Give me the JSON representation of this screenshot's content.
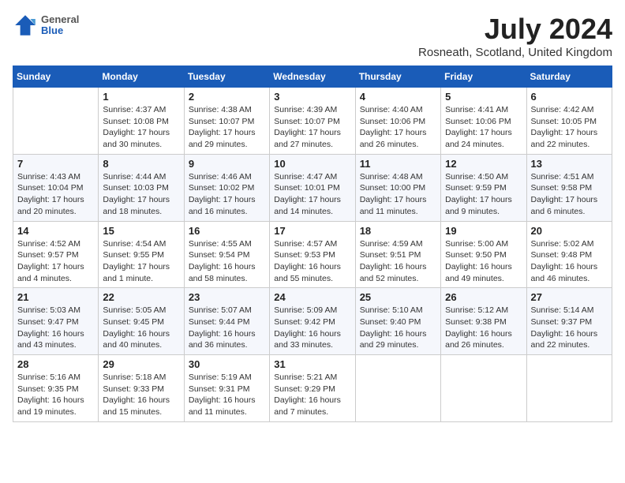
{
  "header": {
    "logo": {
      "line1": "General",
      "line2": "Blue"
    },
    "title": "July 2024",
    "location": "Rosneath, Scotland, United Kingdom"
  },
  "days_of_week": [
    "Sunday",
    "Monday",
    "Tuesday",
    "Wednesday",
    "Thursday",
    "Friday",
    "Saturday"
  ],
  "weeks": [
    [
      {
        "day": "",
        "info": ""
      },
      {
        "day": "1",
        "info": "Sunrise: 4:37 AM\nSunset: 10:08 PM\nDaylight: 17 hours\nand 30 minutes."
      },
      {
        "day": "2",
        "info": "Sunrise: 4:38 AM\nSunset: 10:07 PM\nDaylight: 17 hours\nand 29 minutes."
      },
      {
        "day": "3",
        "info": "Sunrise: 4:39 AM\nSunset: 10:07 PM\nDaylight: 17 hours\nand 27 minutes."
      },
      {
        "day": "4",
        "info": "Sunrise: 4:40 AM\nSunset: 10:06 PM\nDaylight: 17 hours\nand 26 minutes."
      },
      {
        "day": "5",
        "info": "Sunrise: 4:41 AM\nSunset: 10:06 PM\nDaylight: 17 hours\nand 24 minutes."
      },
      {
        "day": "6",
        "info": "Sunrise: 4:42 AM\nSunset: 10:05 PM\nDaylight: 17 hours\nand 22 minutes."
      }
    ],
    [
      {
        "day": "7",
        "info": "Sunrise: 4:43 AM\nSunset: 10:04 PM\nDaylight: 17 hours\nand 20 minutes."
      },
      {
        "day": "8",
        "info": "Sunrise: 4:44 AM\nSunset: 10:03 PM\nDaylight: 17 hours\nand 18 minutes."
      },
      {
        "day": "9",
        "info": "Sunrise: 4:46 AM\nSunset: 10:02 PM\nDaylight: 17 hours\nand 16 minutes."
      },
      {
        "day": "10",
        "info": "Sunrise: 4:47 AM\nSunset: 10:01 PM\nDaylight: 17 hours\nand 14 minutes."
      },
      {
        "day": "11",
        "info": "Sunrise: 4:48 AM\nSunset: 10:00 PM\nDaylight: 17 hours\nand 11 minutes."
      },
      {
        "day": "12",
        "info": "Sunrise: 4:50 AM\nSunset: 9:59 PM\nDaylight: 17 hours\nand 9 minutes."
      },
      {
        "day": "13",
        "info": "Sunrise: 4:51 AM\nSunset: 9:58 PM\nDaylight: 17 hours\nand 6 minutes."
      }
    ],
    [
      {
        "day": "14",
        "info": "Sunrise: 4:52 AM\nSunset: 9:57 PM\nDaylight: 17 hours\nand 4 minutes."
      },
      {
        "day": "15",
        "info": "Sunrise: 4:54 AM\nSunset: 9:55 PM\nDaylight: 17 hours\nand 1 minute."
      },
      {
        "day": "16",
        "info": "Sunrise: 4:55 AM\nSunset: 9:54 PM\nDaylight: 16 hours\nand 58 minutes."
      },
      {
        "day": "17",
        "info": "Sunrise: 4:57 AM\nSunset: 9:53 PM\nDaylight: 16 hours\nand 55 minutes."
      },
      {
        "day": "18",
        "info": "Sunrise: 4:59 AM\nSunset: 9:51 PM\nDaylight: 16 hours\nand 52 minutes."
      },
      {
        "day": "19",
        "info": "Sunrise: 5:00 AM\nSunset: 9:50 PM\nDaylight: 16 hours\nand 49 minutes."
      },
      {
        "day": "20",
        "info": "Sunrise: 5:02 AM\nSunset: 9:48 PM\nDaylight: 16 hours\nand 46 minutes."
      }
    ],
    [
      {
        "day": "21",
        "info": "Sunrise: 5:03 AM\nSunset: 9:47 PM\nDaylight: 16 hours\nand 43 minutes."
      },
      {
        "day": "22",
        "info": "Sunrise: 5:05 AM\nSunset: 9:45 PM\nDaylight: 16 hours\nand 40 minutes."
      },
      {
        "day": "23",
        "info": "Sunrise: 5:07 AM\nSunset: 9:44 PM\nDaylight: 16 hours\nand 36 minutes."
      },
      {
        "day": "24",
        "info": "Sunrise: 5:09 AM\nSunset: 9:42 PM\nDaylight: 16 hours\nand 33 minutes."
      },
      {
        "day": "25",
        "info": "Sunrise: 5:10 AM\nSunset: 9:40 PM\nDaylight: 16 hours\nand 29 minutes."
      },
      {
        "day": "26",
        "info": "Sunrise: 5:12 AM\nSunset: 9:38 PM\nDaylight: 16 hours\nand 26 minutes."
      },
      {
        "day": "27",
        "info": "Sunrise: 5:14 AM\nSunset: 9:37 PM\nDaylight: 16 hours\nand 22 minutes."
      }
    ],
    [
      {
        "day": "28",
        "info": "Sunrise: 5:16 AM\nSunset: 9:35 PM\nDaylight: 16 hours\nand 19 minutes."
      },
      {
        "day": "29",
        "info": "Sunrise: 5:18 AM\nSunset: 9:33 PM\nDaylight: 16 hours\nand 15 minutes."
      },
      {
        "day": "30",
        "info": "Sunrise: 5:19 AM\nSunset: 9:31 PM\nDaylight: 16 hours\nand 11 minutes."
      },
      {
        "day": "31",
        "info": "Sunrise: 5:21 AM\nSunset: 9:29 PM\nDaylight: 16 hours\nand 7 minutes."
      },
      {
        "day": "",
        "info": ""
      },
      {
        "day": "",
        "info": ""
      },
      {
        "day": "",
        "info": ""
      }
    ]
  ]
}
